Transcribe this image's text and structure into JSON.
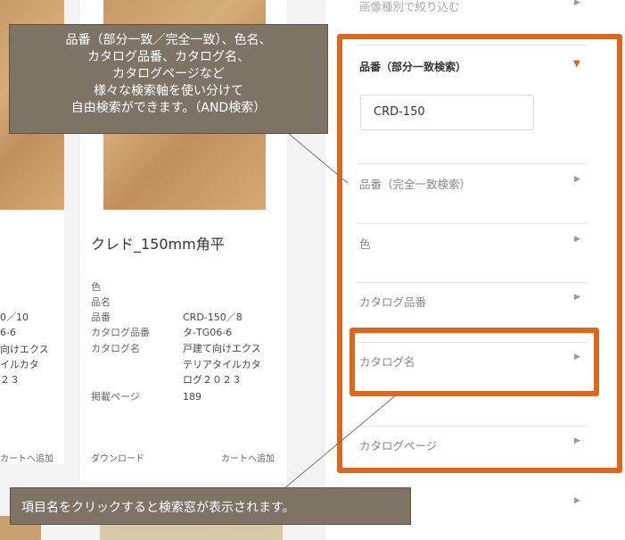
{
  "callouts": {
    "top_lines": [
      "品番（部分一致／完全一致）、色名、",
      "カタログ品番、カタログ名、",
      "カタログページなど",
      "様々な検索軸を使い分けて",
      "自由検索ができます。（AND検索）"
    ],
    "bottom": "項目名をクリックすると検索窓が表示されます。"
  },
  "product_left": {
    "values": [
      "0／10",
      "6-6",
      "向けエクス",
      "イルカタ",
      "２３"
    ],
    "cart_link": "カートへ追加"
  },
  "product_mid": {
    "title": "クレド_150mm角平",
    "labels": [
      "色",
      "品名",
      "品番",
      "カタログ品番",
      "カタログ名",
      "掲載ページ"
    ],
    "part_number": "CRD-150／8",
    "catalog_number": "タ-TG06-6",
    "catalog_name_lines": [
      "戸建て向けエクス",
      "テリアタイルカタ",
      "ログ２０２３"
    ],
    "page": "189",
    "download_link": "ダウンロード",
    "cart_link": "カートへ追加"
  },
  "filters": {
    "top_partial": "画像種別で絞り込む",
    "items": [
      {
        "label": "品番（部分一致検索）",
        "expanded": true
      },
      {
        "label": "品番（完全一致検索）",
        "expanded": false
      },
      {
        "label": "色",
        "expanded": false
      },
      {
        "label": "カタログ品番",
        "expanded": false
      },
      {
        "label": "カタログ名",
        "expanded": false
      },
      {
        "label": "カタログページ",
        "expanded": false
      }
    ],
    "search_value": "CRD-150"
  },
  "colors": {
    "highlight": "#e0661a",
    "callout_bg": "#7d7466"
  }
}
